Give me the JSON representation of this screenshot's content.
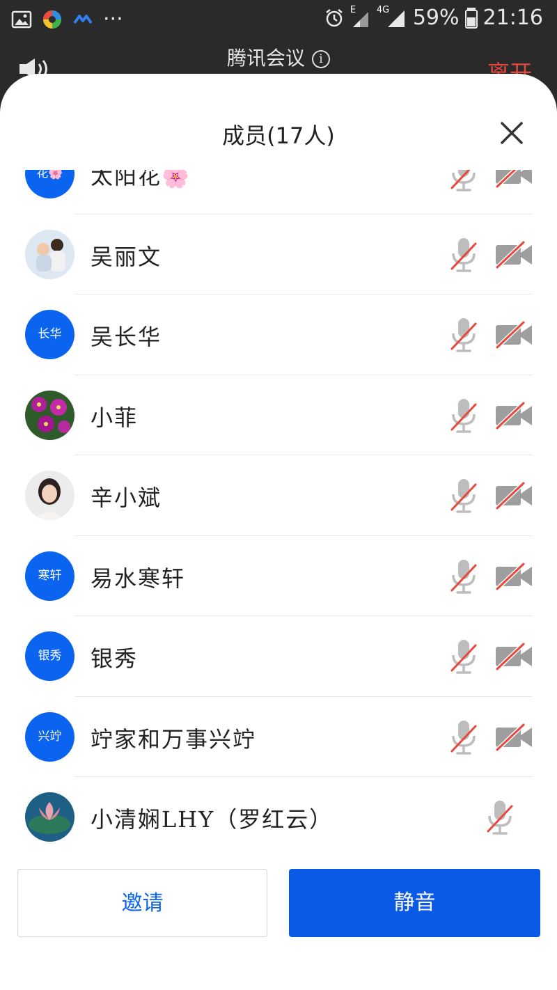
{
  "status_bar": {
    "network_label": "E",
    "network_label_2": "4G",
    "battery": "59%",
    "time": "21:16"
  },
  "meeting": {
    "title": "腾讯会议",
    "info_icon": "i",
    "leave_label": "离开"
  },
  "panel": {
    "title": "成员(17人)"
  },
  "members": [
    {
      "name": "太阳花🌸",
      "avatar_text": "花🌸",
      "avatar_type": "initials",
      "mic": "muted",
      "camera": "off"
    },
    {
      "name": "吴丽文",
      "avatar_text": "",
      "avatar_type": "photo-people",
      "mic": "muted",
      "camera": "off"
    },
    {
      "name": "吴长华",
      "avatar_text": "长华",
      "avatar_type": "initials",
      "mic": "muted",
      "camera": "off"
    },
    {
      "name": "小菲",
      "avatar_text": "",
      "avatar_type": "photo-flowers",
      "mic": "muted",
      "camera": "off"
    },
    {
      "name": "辛小斌",
      "avatar_text": "",
      "avatar_type": "photo-portrait",
      "mic": "muted",
      "camera": "off"
    },
    {
      "name": "易水寒轩",
      "avatar_text": "寒轩",
      "avatar_type": "initials",
      "mic": "muted",
      "camera": "off"
    },
    {
      "name": "银秀",
      "avatar_text": "银秀",
      "avatar_type": "initials",
      "mic": "muted",
      "camera": "off"
    },
    {
      "name": "竚家和万事兴竚",
      "avatar_text": "兴竚",
      "avatar_type": "initials",
      "mic": "muted",
      "camera": "off"
    },
    {
      "name": "小清娴LHY（罗红云）",
      "avatar_text": "",
      "avatar_type": "photo-lotus",
      "mic": "muted",
      "camera": "none"
    }
  ],
  "buttons": {
    "invite": "邀请",
    "mute": "静音"
  },
  "colors": {
    "accent": "#0a64f0",
    "leave": "#e8473c",
    "muted_slash": "#e8473c"
  }
}
